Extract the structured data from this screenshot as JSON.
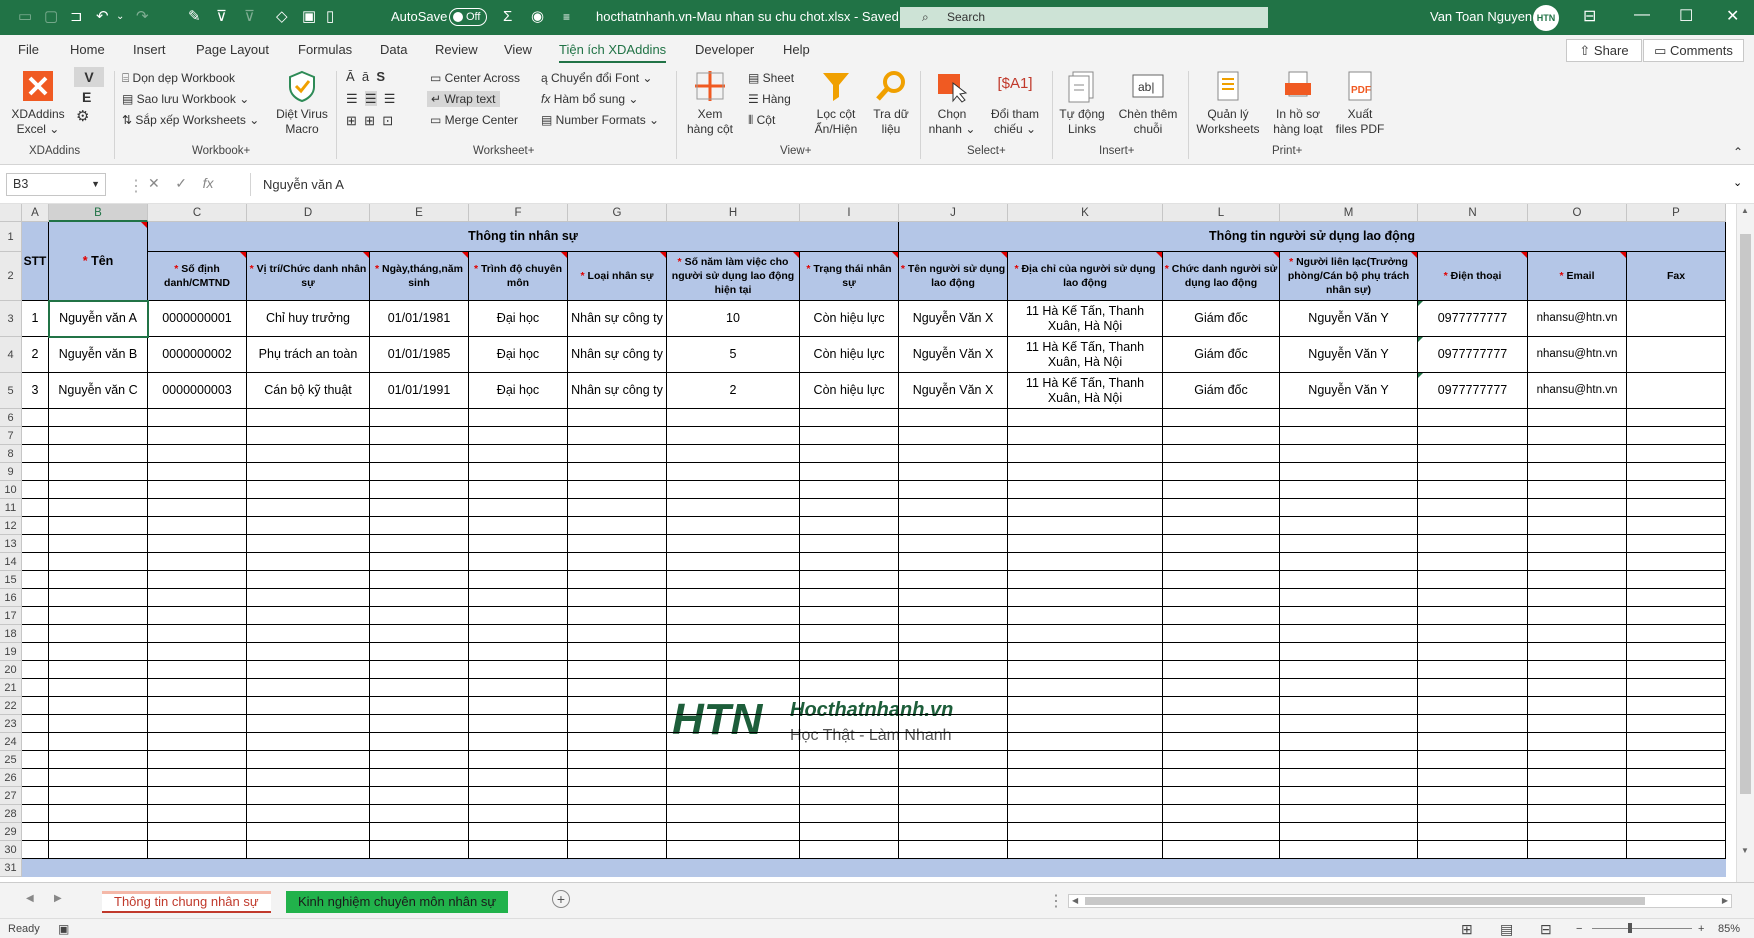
{
  "titlebar": {
    "autosave_label": "AutoSave",
    "autosave_state": "Off",
    "document_title": "hocthatnhanh.vn-Mau nhan su chu chot.xlsx  -  Saved",
    "search_placeholder": "Search",
    "user_name": "Van Toan Nguyen",
    "avatar_text": "HTN",
    "bg_color": "#217346"
  },
  "tabs": [
    "File",
    "Home",
    "Insert",
    "Page Layout",
    "Formulas",
    "Data",
    "Review",
    "View",
    "Tiện ích XDAddins",
    "Developer",
    "Help"
  ],
  "active_tab": "Tiện ích XDAddins",
  "share_label": "Share",
  "comments_label": "Comments",
  "ribbon": {
    "xdaddins": {
      "label1": "XDAddins",
      "label2": "Excel",
      "v": "V",
      "e": "E",
      "group": "XDAddins"
    },
    "workbook": {
      "items": [
        "Dọn dẹp Workbook",
        "Sao lưu Workbook",
        "Sắp xếp Worksheets"
      ],
      "diet1": "Diệt Virus",
      "diet2": "Macro",
      "group": "Workbook+"
    },
    "worksheet": {
      "center_across": "Center Across",
      "wrap_text": "Wrap text",
      "merge_center": "Merge Center",
      "chuyen_doi_font": "Chuyển đổi Font",
      "ham_bo_sung": "Hàm bổ sung",
      "number_formats": "Number Formats",
      "group": "Worksheet+"
    },
    "view": {
      "xem1": "Xem",
      "xem2": "hàng cột",
      "sheet": "Sheet",
      "hang": "Hàng",
      "cot": "Cột",
      "loc1": "Lọc cột",
      "loc2": "Ẩn/Hiện",
      "tra1": "Tra dữ",
      "tra2": "liệu",
      "group": "View+"
    },
    "select": {
      "chon1": "Chọn",
      "chon2": "nhanh",
      "doi1": "Đổi tham",
      "doi2": "chiếu",
      "ref": "[$A1]",
      "group": "Select+"
    },
    "insert": {
      "tu1": "Tự động",
      "tu2": "Links",
      "chen1": "Chèn thêm",
      "chen2": "chuỗi",
      "group": "Insert+"
    },
    "print": {
      "ql1": "Quản lý",
      "ql2": "Worksheets",
      "in1": "In hồ sơ",
      "in2": "hàng loạt",
      "xuat1": "Xuất",
      "xuat2": "files PDF",
      "group": "Print+"
    }
  },
  "formula_bar": {
    "name_box": "B3",
    "fx": "fx",
    "content": "Nguyễn văn A"
  },
  "columns": [
    "A",
    "B",
    "C",
    "D",
    "E",
    "F",
    "G",
    "H",
    "I",
    "J",
    "K",
    "L",
    "M",
    "N",
    "O",
    "P"
  ],
  "selected_column": "B",
  "table": {
    "stt": "STT",
    "ten": "Tên",
    "group1": "Thông tin nhân sự",
    "group2": "Thông tin người sử dụng lao động",
    "headers": [
      "Số định danh/CMTND",
      "Vị trí/Chức danh nhân sự",
      "Ngày,tháng,năm sinh",
      "Trình độ chuyên môn",
      "Loại nhân sự",
      "Số năm làm việc cho người sử dụng lao động hiện tại",
      "Trạng thái nhân sự",
      "Tên người sử dụng lao động",
      "Địa chỉ của người sử dụng lao động",
      "Chức danh người sử dụng lao động",
      "Người liên lạc(Trưởng phòng/Cán bộ phụ trách nhân sự)",
      "Điện thoại",
      "Email",
      "Fax"
    ],
    "required_marker": "*",
    "rows": [
      [
        "1",
        "Nguyễn văn A",
        "0000000001",
        "Chỉ huy trưởng",
        "01/01/1981",
        "Đại học",
        "Nhân sự công ty",
        "10",
        "Còn hiệu lực",
        "Nguyễn Văn X",
        "11 Hà Kế Tấn, Thanh Xuân, Hà Nội",
        "Giám đốc",
        "Nguyễn Văn Y",
        "0977777777",
        "nhansu@htn.vn",
        ""
      ],
      [
        "2",
        "Nguyễn văn B",
        "0000000002",
        "Phụ trách an toàn",
        "01/01/1985",
        "Đại học",
        "Nhân sự công ty",
        "5",
        "Còn hiệu lực",
        "Nguyễn Văn X",
        "11 Hà Kế Tấn, Thanh Xuân, Hà Nội",
        "Giám đốc",
        "Nguyễn Văn Y",
        "0977777777",
        "nhansu@htn.vn",
        ""
      ],
      [
        "3",
        "Nguyễn văn C",
        "0000000003",
        "Cán bộ kỹ thuật",
        "01/01/1991",
        "Đại học",
        "Nhân sự công ty",
        "2",
        "Còn hiệu lực",
        "Nguyễn Văn X",
        "11 Hà Kế Tấn, Thanh Xuân, Hà Nội",
        "Giám đốc",
        "Nguyễn Văn Y",
        "0977777777",
        "nhansu@htn.vn",
        ""
      ]
    ],
    "header_color": "#b4c6e7"
  },
  "row_numbers": [
    "1",
    "2",
    "3",
    "4",
    "5",
    "6",
    "7",
    "8",
    "9",
    "10",
    "11",
    "12",
    "13",
    "14",
    "15",
    "16",
    "17",
    "18",
    "19",
    "20",
    "21",
    "22",
    "23",
    "24",
    "25",
    "26",
    "27",
    "28",
    "29",
    "30",
    "31"
  ],
  "watermark": {
    "brand": "HTN",
    "site": "Hocthatnhanh.vn",
    "slogan": "Học Thật - Làm Nhanh"
  },
  "sheet_tabs": [
    {
      "label": "Thông tin chung nhân sự",
      "active": true
    },
    {
      "label": "Kinh nghiệm chuyên môn nhân sự",
      "active": false
    }
  ],
  "status": {
    "ready": "Ready",
    "zoom": "85%"
  }
}
